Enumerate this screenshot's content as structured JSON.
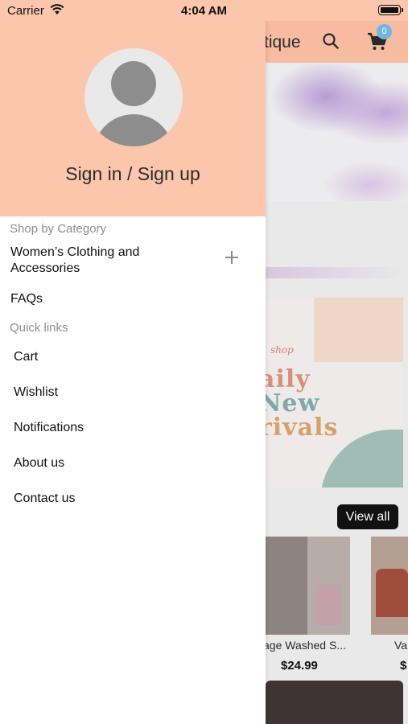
{
  "status_bar": {
    "carrier": "Carrier",
    "time": "4:04 AM"
  },
  "background_app": {
    "title": "tique",
    "cart_badge": "0",
    "banner_shop_text": "shop",
    "banner_line1": "aily",
    "banner_line2": "New",
    "banner_line3": "rivals",
    "view_all": "View all",
    "products": [
      {
        "name": "age Washed S...",
        "price": "$24.99"
      },
      {
        "name": "Val",
        "price": "$"
      }
    ]
  },
  "drawer": {
    "sign_in_label": "Sign in / Sign up",
    "shop_by_category_label": "Shop by Category",
    "categories": [
      {
        "label": "Women’s Clothing and Accessories"
      }
    ],
    "faqs_label": "FAQs",
    "quick_links_label": "Quick links",
    "quick_links": [
      {
        "label": "Cart"
      },
      {
        "label": "Wishlist"
      },
      {
        "label": "Notifications"
      },
      {
        "label": "About us"
      },
      {
        "label": "Contact us"
      }
    ]
  },
  "colors": {
    "header_peach": "#fcc6ac",
    "badge_blue": "#73b6dd",
    "avatar_grey": "#8d8d8d"
  }
}
